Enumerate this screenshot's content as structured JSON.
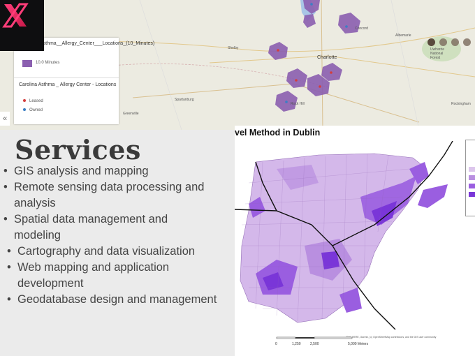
{
  "top_map": {
    "legend": {
      "layer1_title": "Carolina_Asthma__Allergy_Center___Locations_(10_Minutes)",
      "layer1_item": "10.0 Minutes",
      "layer2_title": "Carolina Asthma _ Allergy Center - Locations",
      "items": [
        {
          "label": "Leased",
          "color": "#d43d3d"
        },
        {
          "label": "Owned",
          "color": "#3b7fc4"
        }
      ]
    },
    "place_labels": [
      "Concord",
      "Albemarle",
      "Uwharrie National Forest",
      "Shelby",
      "Charlotte",
      "Spartanburg",
      "Rock Hill",
      "Rockingham",
      "Greenville"
    ],
    "polygon_color": "#8b5fb0",
    "collapse_icon": "«",
    "pager_dots": 4,
    "pager_active_index": 0
  },
  "services": {
    "heading": "Services",
    "items": [
      "GIS analysis and mapping",
      "Remote sensing data processing and analysis",
      "Spatial data management and modeling",
      "Cartography and data visualization",
      "Web mapping and application development",
      "Geodatabase design and management"
    ],
    "lines": [
      [
        "GIS analysis and mapping"
      ],
      [
        "Remote sensing data processing and",
        "analysis"
      ],
      [
        "Spatial data management and",
        "modeling"
      ],
      [
        "Cartography and data visualization"
      ],
      [
        "Web mapping and application",
        "development"
      ],
      [
        "Geodatabase design and management"
      ]
    ]
  },
  "dublin_map": {
    "title": "vel Method in Dublin",
    "scale_labels": [
      "0",
      "1,250",
      "2,500",
      "5,000 Meters"
    ],
    "attribution": "Esri, HERE, Garmin, (c) OpenStreetMap contributors, and the GIS user community",
    "class_colors": [
      "#dcc6ec",
      "#b98fe0",
      "#9a5ee0",
      "#7a36d8"
    ]
  },
  "logo": {
    "icon": "x-logo-icon",
    "accent": "#e8285a"
  }
}
